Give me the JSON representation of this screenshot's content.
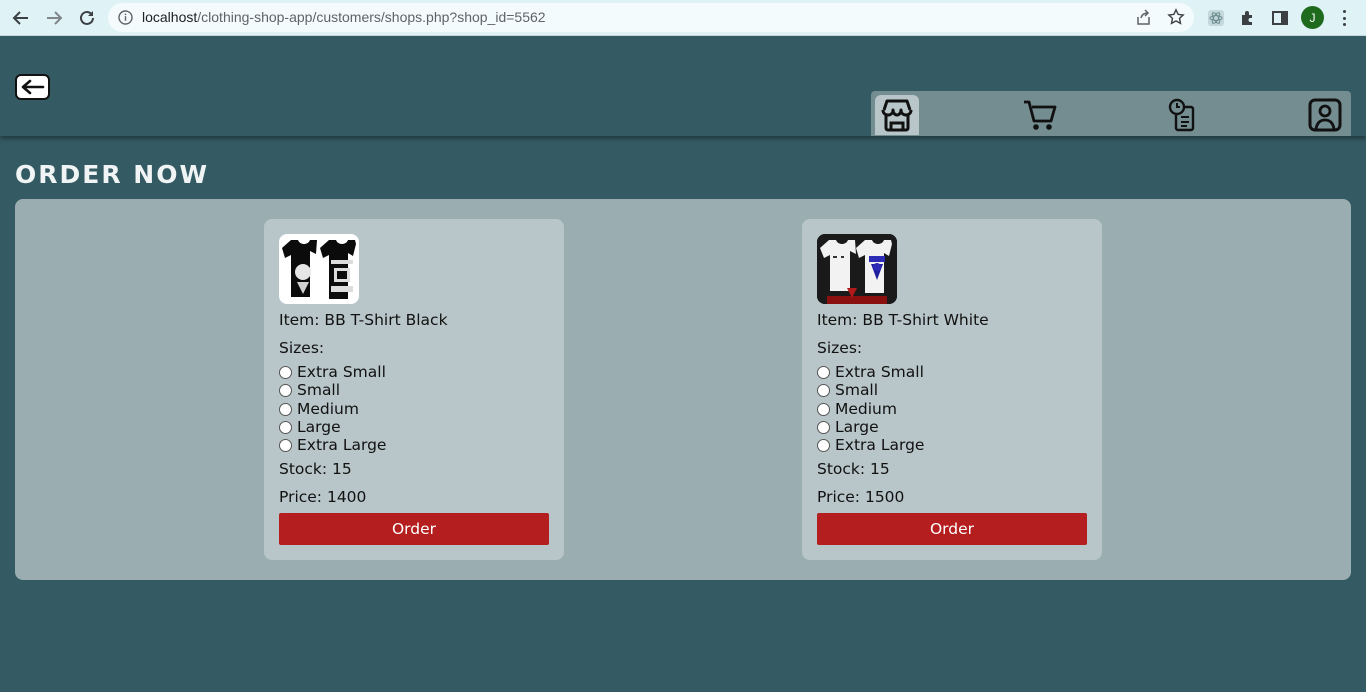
{
  "browser": {
    "url_host": "localhost",
    "url_path": "/clothing-shop-app/customers/shops.php?shop_id=5562",
    "profile_initial": "J"
  },
  "header": {
    "nav": [
      {
        "icon": "shop-icon",
        "active": true
      },
      {
        "icon": "cart-icon",
        "active": false
      },
      {
        "icon": "order-history-icon",
        "active": false
      },
      {
        "icon": "profile-icon",
        "active": false
      }
    ]
  },
  "page": {
    "title": "ORDER NOW"
  },
  "products": [
    {
      "item_label": "Item: BB T-Shirt Black",
      "sizes_label": "Sizes:",
      "sizes": [
        "Extra Small",
        "Small",
        "Medium",
        "Large",
        "Extra Large"
      ],
      "stock_label": "Stock: 15",
      "price_label": "Price: 1400",
      "order_label": "Order",
      "shirt_color": "#0b0b0b"
    },
    {
      "item_label": "Item: BB T-Shirt White",
      "sizes_label": "Sizes:",
      "sizes": [
        "Extra Small",
        "Small",
        "Medium",
        "Large",
        "Extra Large"
      ],
      "stock_label": "Stock: 15",
      "price_label": "Price: 1500",
      "order_label": "Order",
      "shirt_color": "#f2f2f2"
    }
  ],
  "colors": {
    "background": "#345b63",
    "panel": "#9aaeb1",
    "card": "#b9c6c9",
    "order_button": "#b41e1e"
  }
}
